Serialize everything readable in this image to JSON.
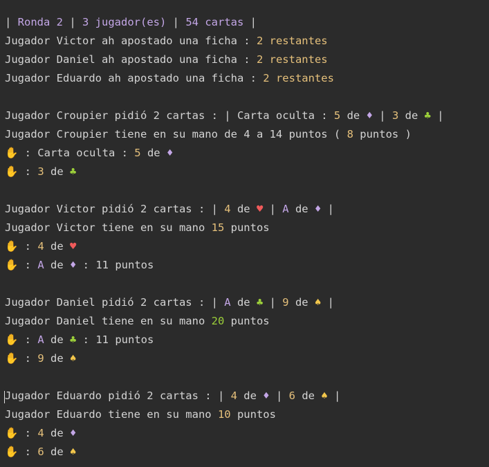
{
  "terminal": {
    "lines": [
      {
        "segs": [
          {
            "t": "| ",
            "c": "pipe"
          },
          {
            "t": "Ronda 2",
            "c": "hdr"
          },
          {
            "t": " | ",
            "c": "pipe"
          },
          {
            "t": "3 jugador(es)",
            "c": "hdr"
          },
          {
            "t": " | ",
            "c": "pipe"
          },
          {
            "t": "54 cartas",
            "c": "hdr"
          },
          {
            "t": " |",
            "c": "pipe"
          }
        ]
      },
      {
        "segs": [
          {
            "t": "Jugador Victor ah apostado una ficha : ",
            "c": "plain"
          },
          {
            "t": "2 restantes",
            "c": "str"
          }
        ]
      },
      {
        "segs": [
          {
            "t": "Jugador Daniel ah apostado una ficha : ",
            "c": "plain"
          },
          {
            "t": "2 restantes",
            "c": "str"
          }
        ]
      },
      {
        "segs": [
          {
            "t": "Jugador Eduardo ah apostado una ficha : ",
            "c": "plain"
          },
          {
            "t": "2 restantes",
            "c": "str"
          }
        ]
      },
      {
        "segs": []
      },
      {
        "segs": [
          {
            "t": "Jugador Croupier pidió 2 cartas : | Carta oculta : ",
            "c": "plain"
          },
          {
            "t": "5",
            "c": "num"
          },
          {
            "t": " de ",
            "c": "plain"
          },
          {
            "t": "♦",
            "c": "diamond"
          },
          {
            "t": " | ",
            "c": "plain"
          },
          {
            "t": "3",
            "c": "num"
          },
          {
            "t": " de ",
            "c": "plain"
          },
          {
            "t": "♣",
            "c": "club"
          },
          {
            "t": " |",
            "c": "plain"
          }
        ]
      },
      {
        "segs": [
          {
            "t": "Jugador Croupier tiene en su mano de 4 a 14 puntos ( ",
            "c": "plain"
          },
          {
            "t": "8",
            "c": "num"
          },
          {
            "t": " puntos )",
            "c": "plain"
          }
        ]
      },
      {
        "segs": [
          {
            "t": "✋",
            "c": "hand"
          },
          {
            "t": " : Carta oculta : ",
            "c": "plain"
          },
          {
            "t": "5",
            "c": "num"
          },
          {
            "t": " de ",
            "c": "plain"
          },
          {
            "t": "♦",
            "c": "diamond"
          }
        ]
      },
      {
        "segs": [
          {
            "t": "✋",
            "c": "hand"
          },
          {
            "t": " : ",
            "c": "plain"
          },
          {
            "t": "3",
            "c": "num"
          },
          {
            "t": " de ",
            "c": "plain"
          },
          {
            "t": "♣",
            "c": "club"
          }
        ]
      },
      {
        "segs": []
      },
      {
        "segs": [
          {
            "t": "Jugador Victor pidió 2 cartas : | ",
            "c": "plain"
          },
          {
            "t": "4",
            "c": "num"
          },
          {
            "t": " de ",
            "c": "plain"
          },
          {
            "t": "♥",
            "c": "heart"
          },
          {
            "t": " | ",
            "c": "plain"
          },
          {
            "t": "A",
            "c": "letter"
          },
          {
            "t": " de ",
            "c": "plain"
          },
          {
            "t": "♦",
            "c": "diamond"
          },
          {
            "t": " |",
            "c": "plain"
          }
        ]
      },
      {
        "segs": [
          {
            "t": "Jugador Victor tiene en su mano ",
            "c": "plain"
          },
          {
            "t": "15",
            "c": "num"
          },
          {
            "t": " puntos",
            "c": "plain"
          }
        ]
      },
      {
        "segs": [
          {
            "t": "✋",
            "c": "hand"
          },
          {
            "t": " : ",
            "c": "plain"
          },
          {
            "t": "4",
            "c": "num"
          },
          {
            "t": " de ",
            "c": "plain"
          },
          {
            "t": "♥",
            "c": "heart"
          }
        ]
      },
      {
        "segs": [
          {
            "t": "✋",
            "c": "hand"
          },
          {
            "t": " : ",
            "c": "plain"
          },
          {
            "t": "A",
            "c": "letter"
          },
          {
            "t": " de ",
            "c": "plain"
          },
          {
            "t": "♦",
            "c": "diamond"
          },
          {
            "t": " : 11 puntos",
            "c": "plain"
          }
        ]
      },
      {
        "segs": []
      },
      {
        "segs": [
          {
            "t": "Jugador Daniel pidió 2 cartas : | ",
            "c": "plain"
          },
          {
            "t": "A",
            "c": "letter"
          },
          {
            "t": " de ",
            "c": "plain"
          },
          {
            "t": "♣",
            "c": "club"
          },
          {
            "t": " | ",
            "c": "plain"
          },
          {
            "t": "9",
            "c": "num"
          },
          {
            "t": " de ",
            "c": "plain"
          },
          {
            "t": "♠",
            "c": "spade"
          },
          {
            "t": " |",
            "c": "plain"
          }
        ]
      },
      {
        "segs": [
          {
            "t": "Jugador Daniel tiene en su mano ",
            "c": "plain"
          },
          {
            "t": "20",
            "c": "green-num"
          },
          {
            "t": " puntos",
            "c": "plain"
          }
        ]
      },
      {
        "segs": [
          {
            "t": "✋",
            "c": "hand"
          },
          {
            "t": " : ",
            "c": "plain"
          },
          {
            "t": "A",
            "c": "letter"
          },
          {
            "t": " de ",
            "c": "plain"
          },
          {
            "t": "♣",
            "c": "club"
          },
          {
            "t": " : 11 puntos",
            "c": "plain"
          }
        ]
      },
      {
        "segs": [
          {
            "t": "✋",
            "c": "hand"
          },
          {
            "t": " : ",
            "c": "plain"
          },
          {
            "t": "9",
            "c": "num"
          },
          {
            "t": " de ",
            "c": "plain"
          },
          {
            "t": "♠",
            "c": "spade"
          }
        ]
      },
      {
        "segs": []
      },
      {
        "segs": [
          {
            "t": "Jugador Eduardo pidió 2 cartas : | ",
            "c": "plain"
          },
          {
            "t": "4",
            "c": "num"
          },
          {
            "t": " de ",
            "c": "plain"
          },
          {
            "t": "♦",
            "c": "diamond"
          },
          {
            "t": " | ",
            "c": "plain"
          },
          {
            "t": "6",
            "c": "num"
          },
          {
            "t": " de ",
            "c": "plain"
          },
          {
            "t": "♠",
            "c": "spade"
          },
          {
            "t": " |",
            "c": "plain"
          }
        ]
      },
      {
        "segs": [
          {
            "t": "Jugador Eduardo tiene en su mano ",
            "c": "plain"
          },
          {
            "t": "10",
            "c": "num"
          },
          {
            "t": " puntos",
            "c": "plain"
          }
        ]
      },
      {
        "segs": [
          {
            "t": "✋",
            "c": "hand"
          },
          {
            "t": " : ",
            "c": "plain"
          },
          {
            "t": "4",
            "c": "num"
          },
          {
            "t": " de ",
            "c": "plain"
          },
          {
            "t": "♦",
            "c": "diamond"
          }
        ]
      },
      {
        "segs": [
          {
            "t": "✋",
            "c": "hand"
          },
          {
            "t": " : ",
            "c": "plain"
          },
          {
            "t": "6",
            "c": "num"
          },
          {
            "t": " de ",
            "c": "plain"
          },
          {
            "t": "♠",
            "c": "spade"
          }
        ]
      }
    ]
  }
}
